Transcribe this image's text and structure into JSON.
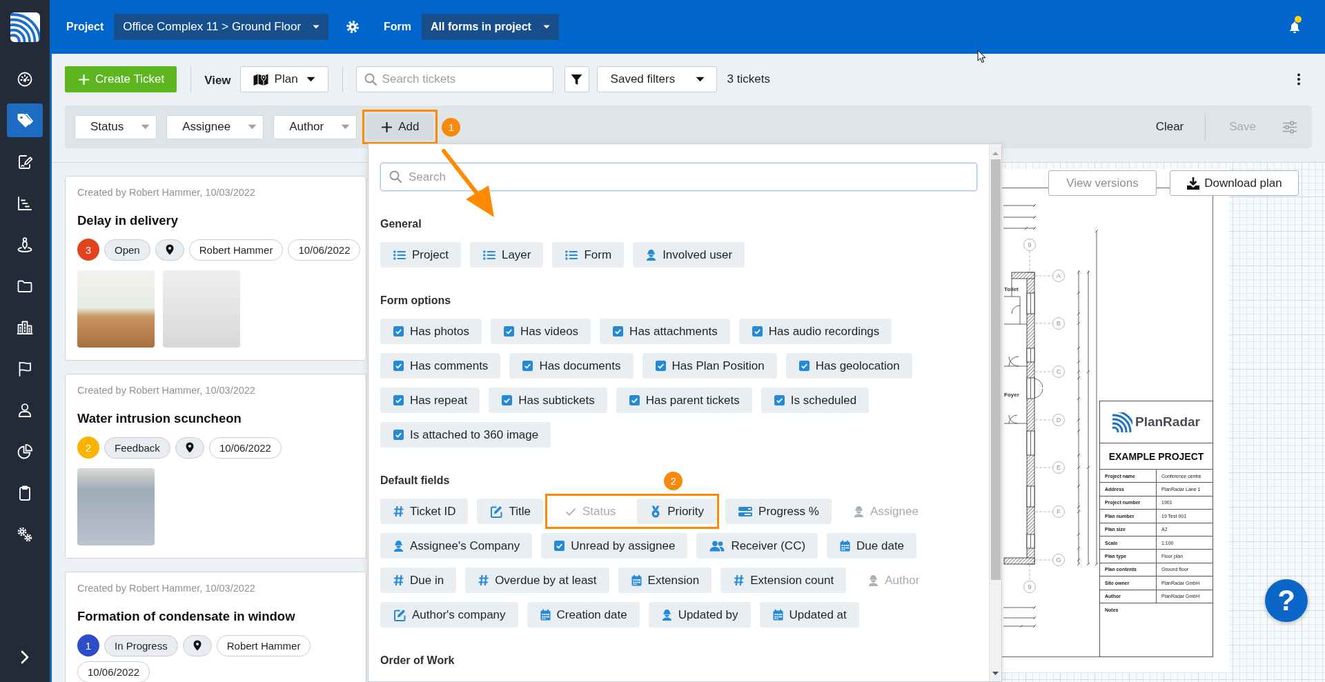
{
  "sidebar": {
    "items": [
      {
        "selected": false
      },
      {
        "selected": true
      },
      {
        "selected": false
      },
      {
        "selected": false
      },
      {
        "selected": false
      },
      {
        "selected": false
      },
      {
        "selected": false
      },
      {
        "selected": false
      },
      {
        "selected": false
      },
      {
        "selected": false
      },
      {
        "selected": false
      },
      {
        "selected": false
      }
    ]
  },
  "top_bar": {
    "project_label": "Project",
    "project": "Office Complex 11 > Ground Floor",
    "form_label": "Form",
    "form": "All forms in project",
    "notification": true
  },
  "toolbar": {
    "create_button": "Create Ticket",
    "view_label": "View",
    "view": "Plan",
    "search": {
      "placeholder": "Search tickets"
    },
    "saved_filters": "Saved filters",
    "ticket_count": "3 tickets"
  },
  "filter_bar": {
    "filters": [
      "Status",
      "Assignee",
      "Author"
    ],
    "add_button": {
      "label": "Add",
      "highlighted": true,
      "badge": "1"
    },
    "clear_button": "Clear",
    "save_button": {
      "label": "Save",
      "disabled": true
    }
  },
  "tickets": [
    {
      "created": "Created by Robert Hammer, 10/03/2022",
      "title": "Delay in delivery",
      "priority": "3",
      "color": "#e2431c",
      "status": "Open",
      "location": true,
      "assignee": "Robert Hammer",
      "due_date": "10/06/2022",
      "photos": [
        {
          "kind": "photo"
        },
        {
          "kind": "photo"
        }
      ]
    },
    {
      "created": "Created by Robert Hammer, 10/03/2022",
      "title": "Water intrusion scuncheon",
      "priority": "2",
      "color": "#f8b400",
      "status": "Feedback",
      "location": true,
      "due_date": "10/06/2022",
      "photos": [
        {
          "kind": "photo"
        }
      ]
    },
    {
      "created": "Created by Robert Hammer, 10/03/2022",
      "title": "Formation of condensate in window",
      "priority": "1",
      "color": "#2f4dc8",
      "status": "In Progress",
      "location": true,
      "assignee": "Robert Hammer",
      "due_date": "10/06/2022"
    }
  ],
  "field_picker": {
    "search": {
      "placeholder": "Search"
    },
    "sections": [
      {
        "heading": "General",
        "rows": [
          [
            {
              "kind": "list",
              "label": "Project",
              "disabled": false
            },
            {
              "kind": "list",
              "label": "Layer",
              "disabled": false
            },
            {
              "kind": "list",
              "label": "Form",
              "disabled": false
            },
            {
              "kind": "user",
              "label": "Involved user",
              "disabled": false
            }
          ]
        ]
      },
      {
        "heading": "Form options",
        "rows": [
          [
            {
              "kind": "boolean",
              "label": "Has photos",
              "disabled": false
            },
            {
              "kind": "boolean",
              "label": "Has videos",
              "disabled": false
            },
            {
              "kind": "boolean",
              "label": "Has attachments",
              "disabled": false
            },
            {
              "kind": "boolean",
              "label": "Has audio recordings",
              "disabled": false
            }
          ],
          [
            {
              "kind": "boolean",
              "label": "Has comments",
              "disabled": false
            },
            {
              "kind": "boolean",
              "label": "Has documents",
              "disabled": false
            },
            {
              "kind": "boolean",
              "label": "Has Plan Position",
              "disabled": false
            },
            {
              "kind": "boolean",
              "label": "Has geolocation",
              "disabled": false
            }
          ],
          [
            {
              "kind": "boolean",
              "label": "Has repeat",
              "disabled": false
            },
            {
              "kind": "boolean",
              "label": "Has subtickets",
              "disabled": false
            },
            {
              "kind": "boolean",
              "label": "Has parent tickets",
              "disabled": false
            },
            {
              "kind": "boolean",
              "label": "Is scheduled",
              "disabled": false
            }
          ],
          [
            {
              "kind": "boolean",
              "label": "Is attached to 360 image",
              "disabled": false
            }
          ]
        ]
      },
      {
        "heading": "Default fields",
        "rows": [
          [
            {
              "kind": "number",
              "label": "Ticket ID",
              "disabled": false
            },
            {
              "kind": "text",
              "label": "Title",
              "disabled": false
            },
            {
              "kind": "callout",
              "badge": "2",
              "chips": [
                {
                  "kind": "status",
                  "label": "Status",
                  "disabled": true
                },
                {
                  "kind": "priority",
                  "label": "Priority",
                  "disabled": false
                }
              ]
            },
            {
              "kind": "progress",
              "label": "Progress %",
              "disabled": false
            },
            {
              "kind": "user",
              "label": "Assignee",
              "disabled": true
            }
          ],
          [
            {
              "kind": "user",
              "label": "Assignee's Company",
              "disabled": false
            },
            {
              "kind": "boolean",
              "label": "Unread by assignee",
              "disabled": false
            },
            {
              "kind": "group",
              "label": "Receiver (CC)",
              "disabled": false
            },
            {
              "kind": "date",
              "label": "Due date",
              "disabled": false
            }
          ],
          [
            {
              "kind": "number",
              "label": "Due in",
              "disabled": false
            },
            {
              "kind": "number",
              "label": "Overdue by at least",
              "disabled": false
            },
            {
              "kind": "date",
              "label": "Extension",
              "disabled": false
            },
            {
              "kind": "number",
              "label": "Extension count",
              "disabled": false
            },
            {
              "kind": "user",
              "label": "Author",
              "disabled": true
            }
          ],
          [
            {
              "kind": "text",
              "label": "Author's company",
              "disabled": false
            },
            {
              "kind": "date",
              "label": "Creation date",
              "disabled": false
            },
            {
              "kind": "user",
              "label": "Updated by",
              "disabled": false
            },
            {
              "kind": "date",
              "label": "Updated at",
              "disabled": false
            }
          ]
        ]
      },
      {
        "heading": "Order of Work"
      }
    ]
  },
  "plan": {
    "buttons": [
      {
        "label": "View versions",
        "kind": "versions",
        "disabled": true
      },
      {
        "label": "Download plan",
        "kind": "download",
        "disabled": false
      }
    ],
    "axis_markers": [
      {
        "label": "9"
      },
      {
        "label": "A"
      },
      {
        "label": "B"
      },
      {
        "label": "C"
      },
      {
        "label": "D"
      },
      {
        "label": "E"
      },
      {
        "label": "F"
      },
      {
        "label": "G"
      },
      {
        "label": "9"
      }
    ],
    "room_labels": [
      "Toilet",
      "Foyer"
    ],
    "title_block": {
      "brand": "PlanRadar",
      "project": "EXAMPLE PROJECT",
      "rows": [
        {
          "label": "Project name",
          "value": "Conference centre"
        },
        {
          "label": "Address",
          "value": "PlanRadar Lane 1"
        },
        {
          "label": "Project number",
          "value": "1901"
        },
        {
          "label": "Plan number",
          "value": "19 Test 001"
        },
        {
          "label": "Plan size",
          "value": "A2"
        },
        {
          "label": "Scale",
          "value": "1:100"
        },
        {
          "label": "Plan type",
          "value": "Floor plan"
        },
        {
          "label": "Plan contents",
          "value": "Ground floor"
        },
        {
          "label": "Site owner",
          "value": "PlanRadar GmbH"
        },
        {
          "label": "Author",
          "value": "PlanRadar GmbH"
        },
        {
          "label": "Notes"
        }
      ]
    },
    "help_button": "?"
  }
}
